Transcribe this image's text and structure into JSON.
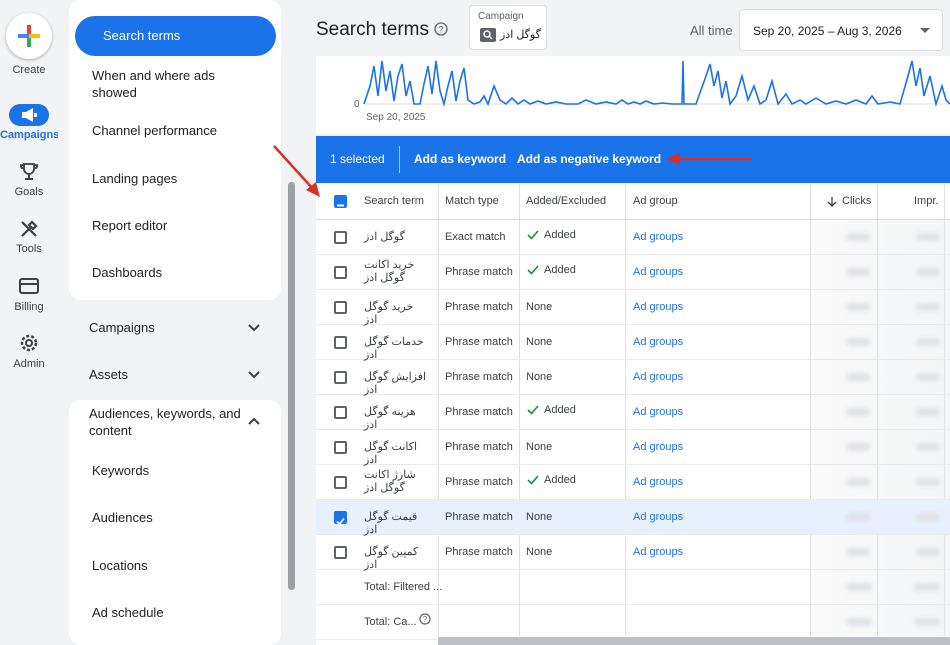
{
  "rail": {
    "create": "Create",
    "campaigns": "Campaigns",
    "goals": "Goals",
    "tools": "Tools",
    "billing": "Billing",
    "admin": "Admin"
  },
  "sidebar": {
    "active": "Search terms",
    "items": [
      "When and where ads showed",
      "Channel performance",
      "Landing pages",
      "Report editor",
      "Dashboards"
    ],
    "sections": [
      "Campaigns",
      "Assets",
      "Audiences, keywords, and content"
    ],
    "sub_items": [
      "Keywords",
      "Audiences",
      "Locations",
      "Ad schedule"
    ]
  },
  "header": {
    "title": "Search terms",
    "campaign_label": "Campaign",
    "campaign_value": "گوگل ادز",
    "all_time": "All time",
    "date_range": "Sep 20, 2025 – Aug 3, 2026"
  },
  "chart": {
    "zero_label": "0",
    "start_date": "Sep 20, 2025"
  },
  "action_bar": {
    "selected": "1 selected",
    "add_keyword": "Add as keyword",
    "add_negative": "Add as negative keyword"
  },
  "table": {
    "columns": [
      "Search term",
      "Match type",
      "Added/Excluded",
      "Ad group",
      "Clicks",
      "Impr."
    ],
    "rows": [
      {
        "term": "گوگل ادز",
        "match": "Exact match",
        "added": "Added",
        "group": "Ad groups"
      },
      {
        "term": "خرید اکانت گوگل ادز",
        "match": "Phrase match",
        "added": "Added",
        "group": "Ad groups"
      },
      {
        "term": "خرید گوگل ادز",
        "match": "Phrase match",
        "added": "None",
        "group": "Ad groups"
      },
      {
        "term": "خدمات گوگل ادز",
        "match": "Phrase match",
        "added": "None",
        "group": "Ad groups"
      },
      {
        "term": "افزایش گوگل ادز",
        "match": "Phrase match",
        "added": "None",
        "group": "Ad groups"
      },
      {
        "term": "هزینه گوگل ادز",
        "match": "Phrase match",
        "added": "Added",
        "group": "Ad groups"
      },
      {
        "term": "اکانت گوگل ادز",
        "match": "Phrase match",
        "added": "None",
        "group": "Ad groups"
      },
      {
        "term": "شارژ اکانت گوگل ادز",
        "match": "Phrase match",
        "added": "Added",
        "group": "Ad groups"
      },
      {
        "term": "قیمت گوگل ادز",
        "match": "Phrase match",
        "added": "None",
        "group": "Ad groups"
      },
      {
        "term": "کمپین گوگل ادز",
        "match": "Phrase match",
        "added": "None",
        "group": "Ad groups"
      }
    ],
    "total_filtered": "Total: Filtered ...",
    "total_campaign": "Total: Ca..."
  },
  "colors": {
    "accent": "#1a73e8",
    "arrow": "#d93025",
    "check": "#1e8e3e"
  }
}
